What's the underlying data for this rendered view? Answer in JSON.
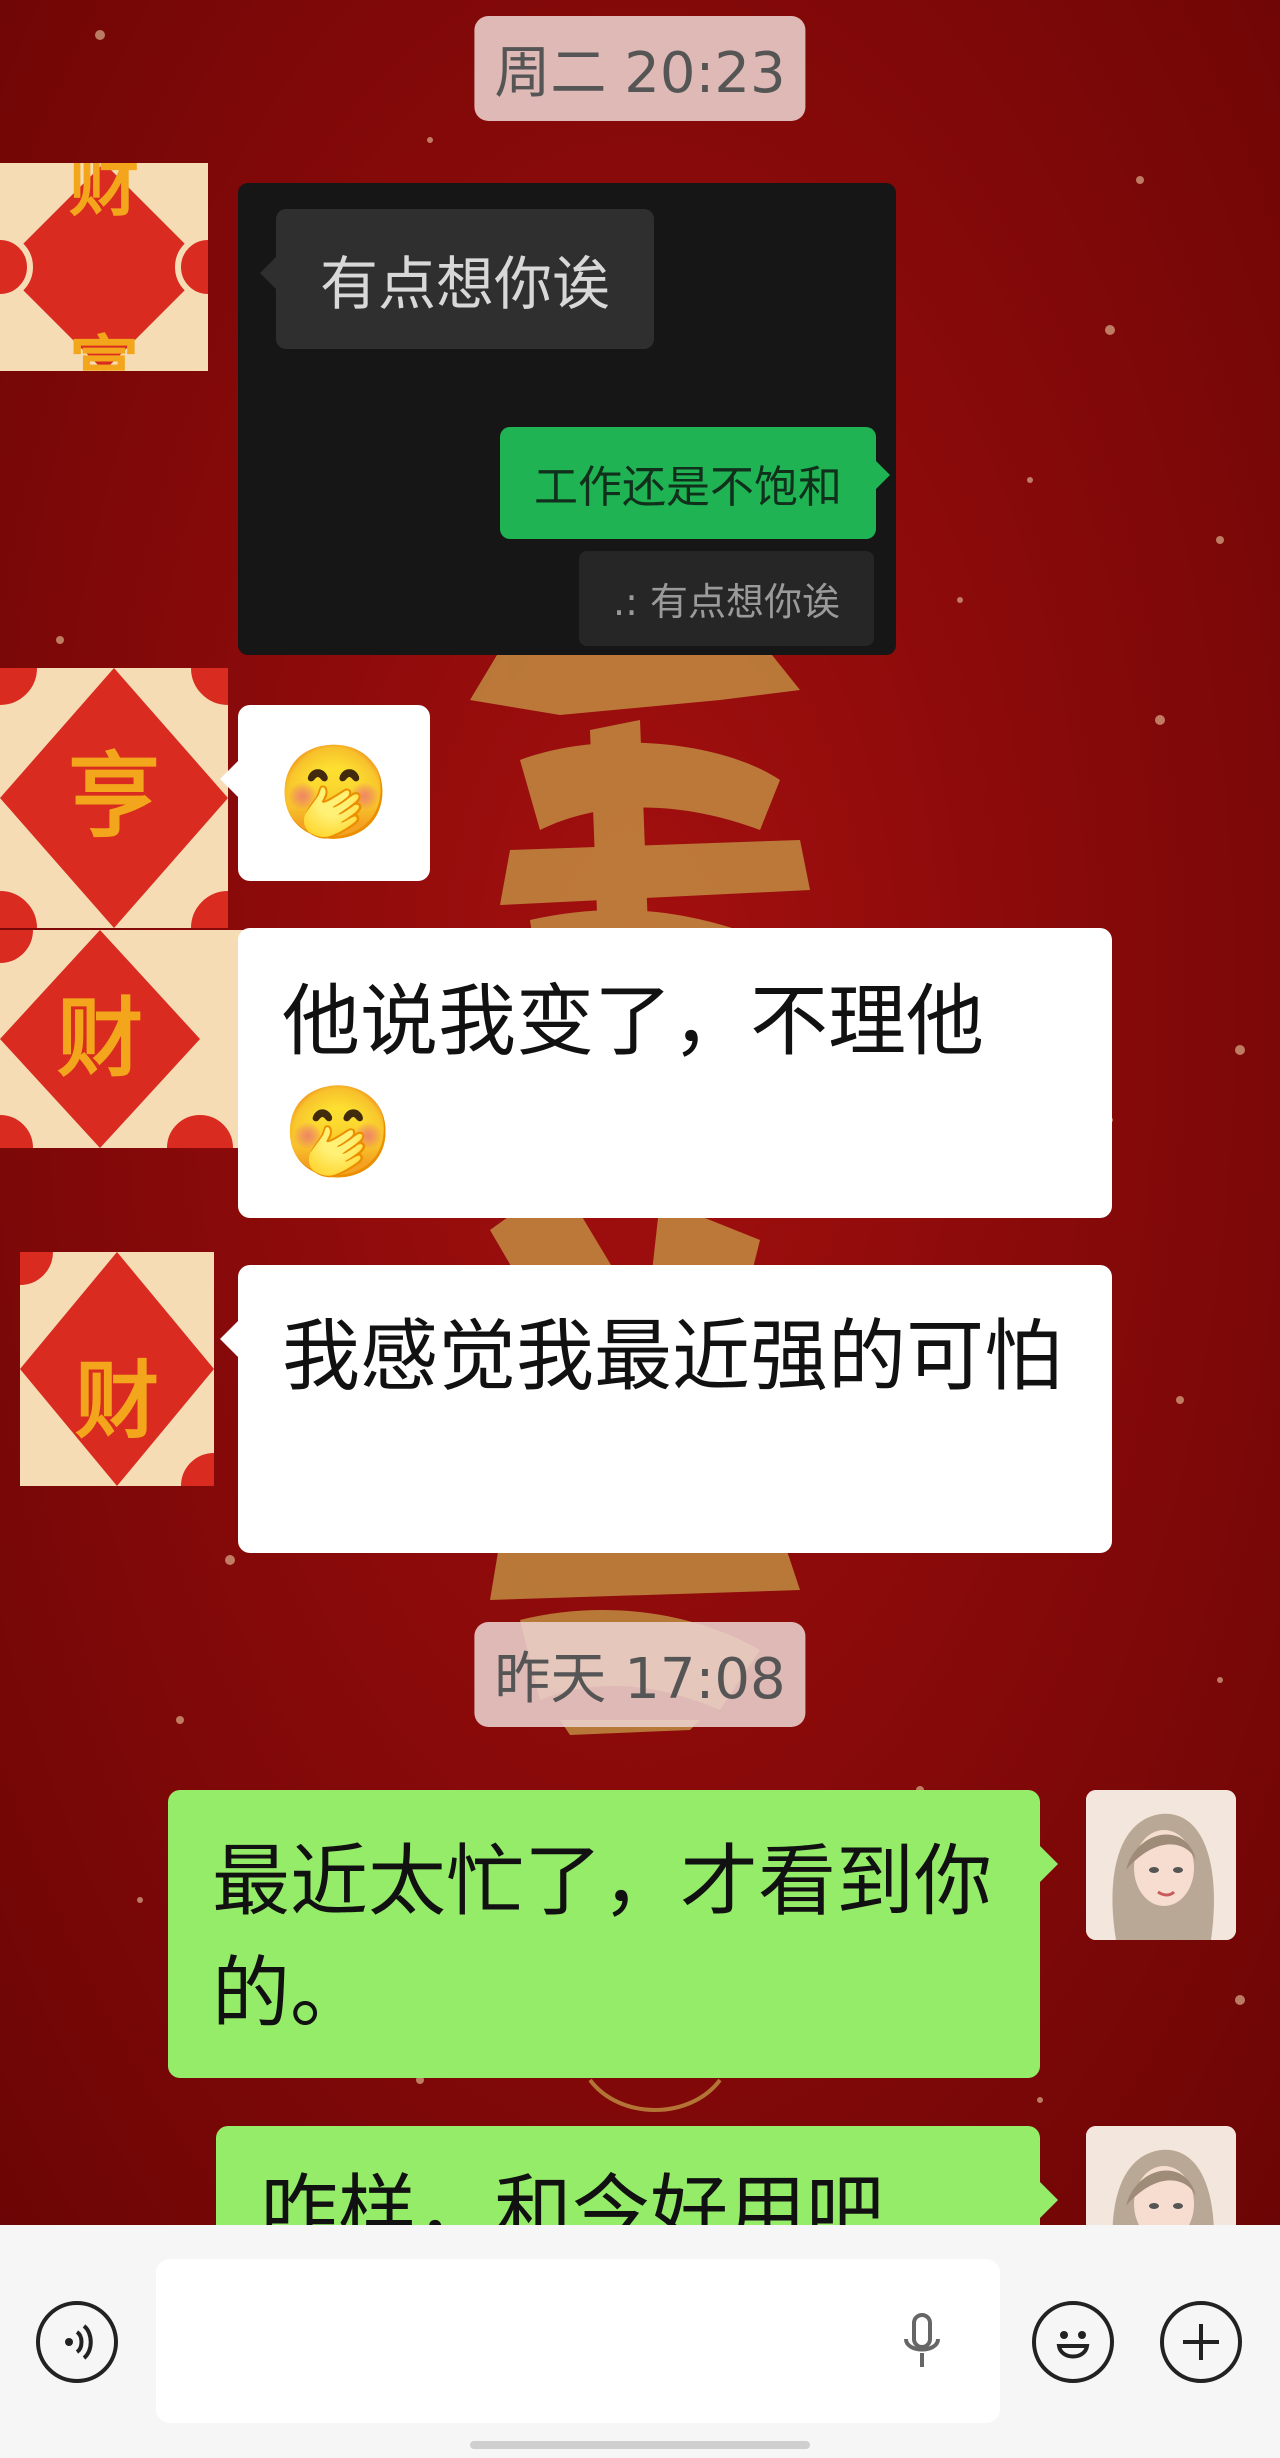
{
  "timestamps": [
    "周二 20:23",
    "昨天 17:08"
  ],
  "quoted_screenshot": {
    "incoming": "有点想你诶",
    "outgoing": "工作还是不饱和",
    "quote": ".: 有点想你诶"
  },
  "avatar_glyphs": {
    "top": "财富",
    "mid1": "亨",
    "mid2": "财",
    "mid3": "财"
  },
  "messages": [
    {
      "side": "left",
      "text": "🤭"
    },
    {
      "side": "left",
      "text": "他说我变了，不理他"
    },
    {
      "side": "left",
      "emoji": "🤭"
    },
    {
      "side": "left",
      "text": "我感觉我最近强的可怕"
    },
    {
      "side": "right",
      "text": "最近太忙了，才看到你的。"
    },
    {
      "side": "right",
      "text": "咋样，和今好用吧"
    }
  ],
  "colors": {
    "background": "#8a0a0a",
    "bubble_in": "#ffffff",
    "bubble_out": "#95ec69",
    "gold": "#c9a24a"
  },
  "icons": [
    "voice-mode-icon",
    "microphone-icon",
    "emoji-icon",
    "plus-icon"
  ]
}
